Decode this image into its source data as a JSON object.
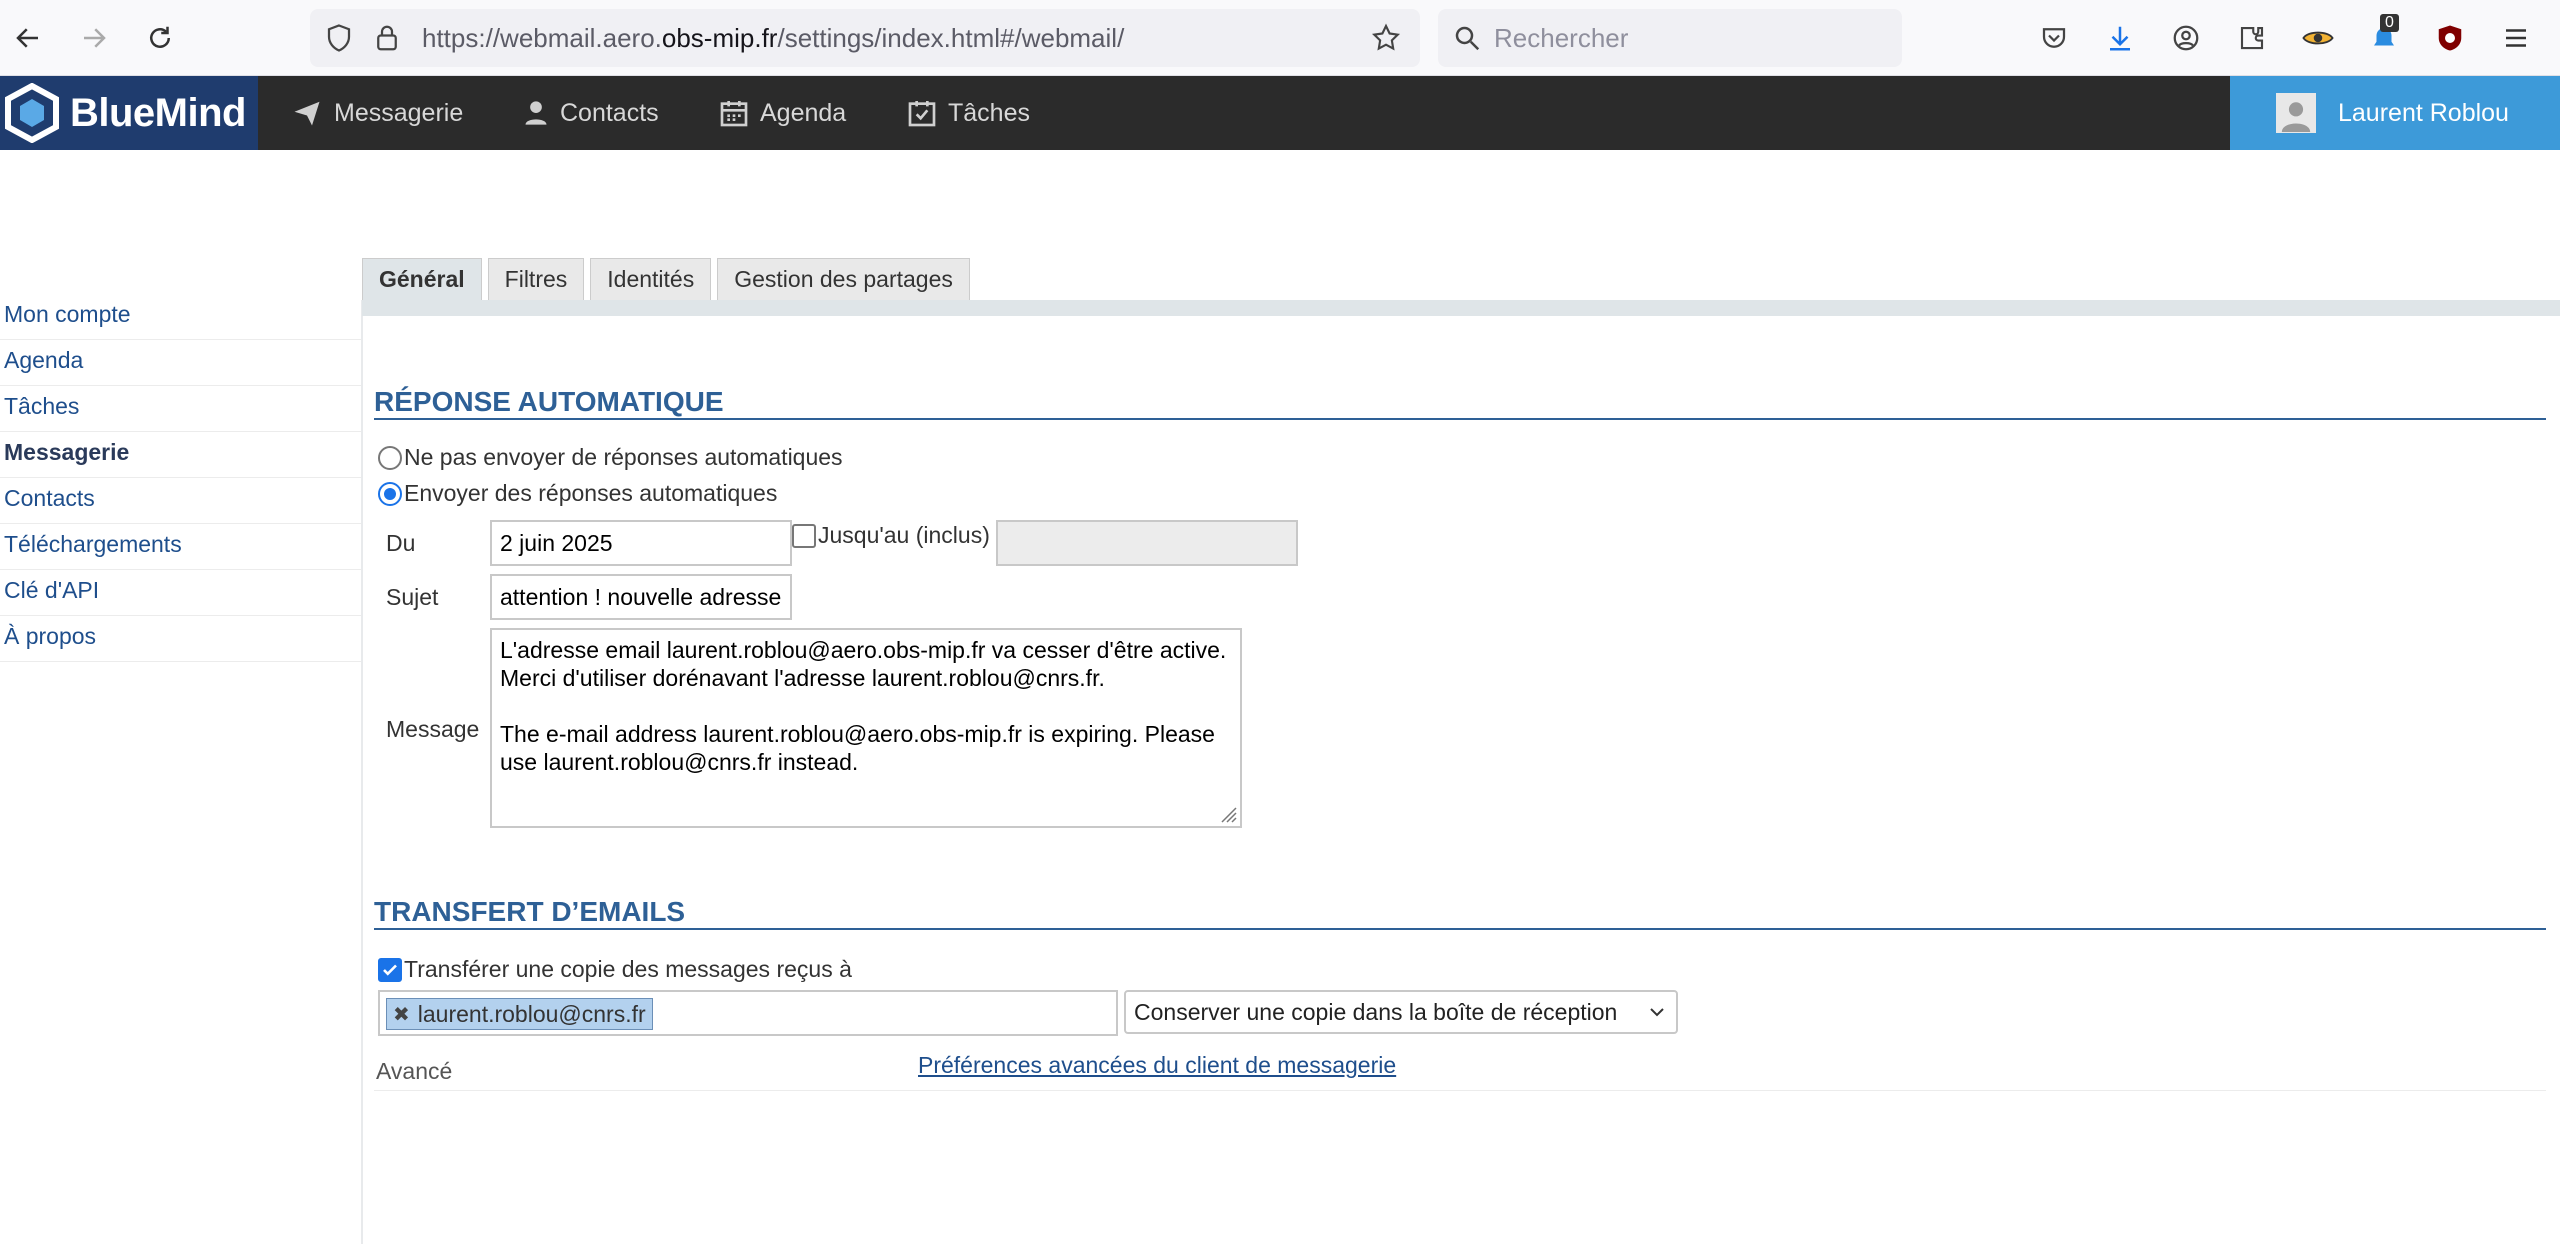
{
  "browser": {
    "url_prefix": "https://webmail.aero.",
    "url_host": "obs-mip.fr",
    "url_suffix": "/settings/index.html#/webmail/",
    "search_placeholder": "Rechercher",
    "notification_count": "0",
    "icons": [
      "back-arrow-icon",
      "forward-arrow-icon",
      "reload-icon",
      "shield-icon",
      "lock-icon",
      "star-icon",
      "search-icon",
      "pocket-icon",
      "download-icon",
      "account-icon",
      "extensions-icon",
      "eye-icon",
      "notification-icon",
      "ublock-icon",
      "menu-icon"
    ]
  },
  "app": {
    "logo": "BlueMind",
    "nav": [
      {
        "label": "Messagerie",
        "icon": "paper-plane-icon"
      },
      {
        "label": "Contacts",
        "icon": "person-icon"
      },
      {
        "label": "Agenda",
        "icon": "calendar-icon"
      },
      {
        "label": "Tâches",
        "icon": "task-check-icon"
      }
    ],
    "user": "Laurent Roblou"
  },
  "sidebar": {
    "items": [
      "Mon compte",
      "Agenda",
      "Tâches",
      "Messagerie",
      "Contacts",
      "Téléchargements",
      "Clé d'API",
      "À propos"
    ],
    "active": "Messagerie"
  },
  "tabs": [
    {
      "label": "Général",
      "active": true
    },
    {
      "label": "Filtres"
    },
    {
      "label": "Identités"
    },
    {
      "label": "Gestion des partages"
    }
  ],
  "auto_reply": {
    "title": "RÉPONSE AUTOMATIQUE",
    "option_off": "Ne pas envoyer de réponses automatiques",
    "option_on": "Envoyer des réponses automatiques",
    "selected": "on",
    "from_label": "Du",
    "from_value": "2 juin 2025",
    "until_label": "Jusqu'au (inclus)",
    "until_checked": false,
    "until_value": "",
    "subject_label": "Sujet",
    "subject_value": "attention ! nouvelle adresse",
    "message_label": "Message",
    "message_value": "L'adresse email laurent.roblou@aero.obs-mip.fr va cesser d'être active. Merci d'utiliser dorénavant l'adresse laurent.roblou@cnrs.fr.\n\nThe e-mail address laurent.roblou@aero.obs-mip.fr is expiring. Please use laurent.roblou@cnrs.fr instead."
  },
  "forward": {
    "title": "TRANSFERT D’EMAILS",
    "checkbox_label": "Transférer une copie des messages reçus à",
    "checked": true,
    "recipient": "laurent.roblou@cnrs.fr",
    "keep_copy_option": "Conserver une copie dans la boîte de réception",
    "advanced_label": "Avancé",
    "advanced_link": "Préférences avancées du client de messagerie"
  },
  "colors": {
    "accent": "#2e6096",
    "header_bg": "#2b2b2b",
    "logo_bg": "#1f3c6e",
    "user_bg": "#3d9ad9",
    "link": "#1e4e8c",
    "chip_bg": "#b3d1ee"
  }
}
